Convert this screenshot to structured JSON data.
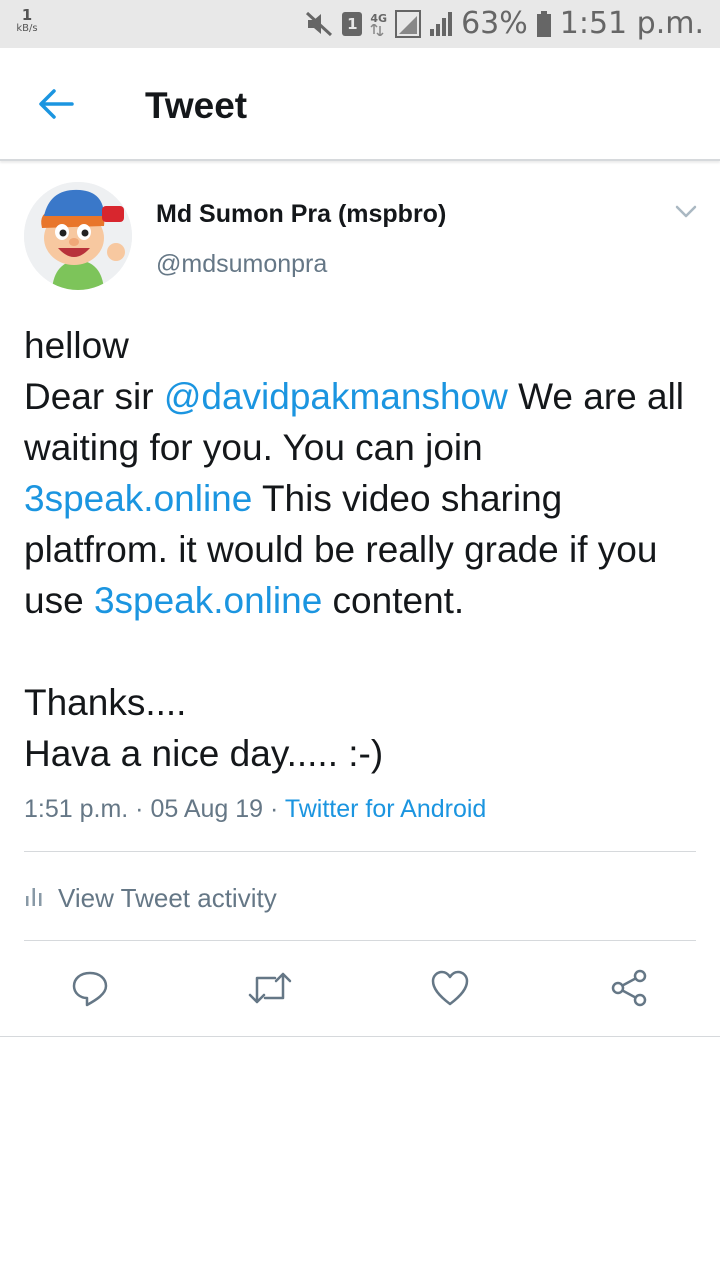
{
  "status_bar": {
    "speed_value": "1",
    "speed_unit": "kB/s",
    "sim_label": "1",
    "network_label": "4G",
    "battery": "63%",
    "time": "1:51 p.m."
  },
  "app_bar": {
    "title": "Tweet"
  },
  "tweet": {
    "author_name": "Md Sumon Pra (mspbro)",
    "author_handle": "@mdsumonpra",
    "body": {
      "line1": "hellow",
      "part1": "Dear sir ",
      "mention": "@davidpakmanshow",
      "part2": " We are all waiting for you. You can join ",
      "link1": "3speak.online",
      "part3": " This video sharing platfrom. it would be really grade if you use ",
      "link2": "3speak.online",
      "part4": " content.",
      "closing": "Thanks....\nHava a nice day..... :-)"
    },
    "time": "1:51 p.m.",
    "date": "05 Aug 19",
    "source": "Twitter for Android",
    "separator": " · "
  },
  "activity": {
    "label": "View Tweet activity"
  },
  "colors": {
    "accent": "#1b95e0",
    "text_primary": "#14171a",
    "text_secondary": "#657786",
    "divider": "#d6d9dc",
    "status_bar_bg": "#e8e8e8"
  },
  "icons": {
    "back": "arrow-left-icon",
    "menu": "chevron-down-icon",
    "activity": "bar-chart-icon",
    "reply": "reply-icon",
    "retweet": "retweet-icon",
    "like": "heart-icon",
    "share": "share-icon"
  }
}
